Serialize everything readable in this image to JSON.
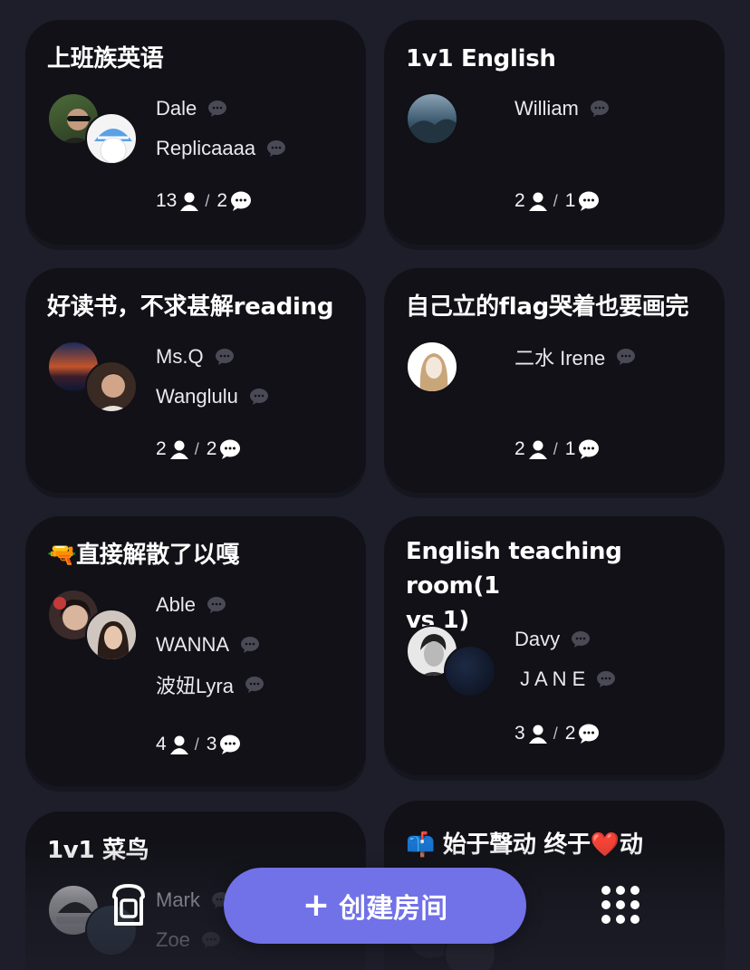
{
  "rooms": [
    {
      "title": "上班族英语",
      "members": [
        "Dale",
        "Replicaaaa"
      ],
      "people_count": "13",
      "message_count": "2"
    },
    {
      "title": "1v1 English",
      "members": [
        "William"
      ],
      "people_count": "2",
      "message_count": "1"
    },
    {
      "title": "好读书，不求甚解reading",
      "members": [
        "Ms.Q",
        "Wanglulu"
      ],
      "people_count": "2",
      "message_count": "2"
    },
    {
      "title": "自己立的flag哭着也要画完",
      "members": [
        "二水 Irene"
      ],
      "people_count": "2",
      "message_count": "1"
    },
    {
      "title": "🔫直接解散了以嘎",
      "members": [
        "Able",
        "WANNA",
        "波妞Lyra"
      ],
      "people_count": "4",
      "message_count": "3"
    },
    {
      "title": " English teaching room(1",
      "title_line2": "vs 1)",
      "members": [
        "Davy",
        " J A N E"
      ],
      "people_count": "3",
      "message_count": "2"
    },
    {
      "title": "1v1 菜鸟",
      "members": [
        "Mark",
        "Zoe"
      ]
    },
    {
      "title": "📫 始于聲动 终于❤️动",
      "members": []
    }
  ],
  "stats_separator": "/",
  "create_button": {
    "plus": "+",
    "label": "创建房间"
  },
  "icons": {
    "people": "person-icon",
    "messages": "chat-bubble-icon",
    "toast": "toast-icon",
    "grid": "grid-dots-icon"
  },
  "colors": {
    "background": "#1e1e2a",
    "card": "#111117",
    "accent": "#7171e8",
    "muted_bubble": "#4a4a56"
  }
}
